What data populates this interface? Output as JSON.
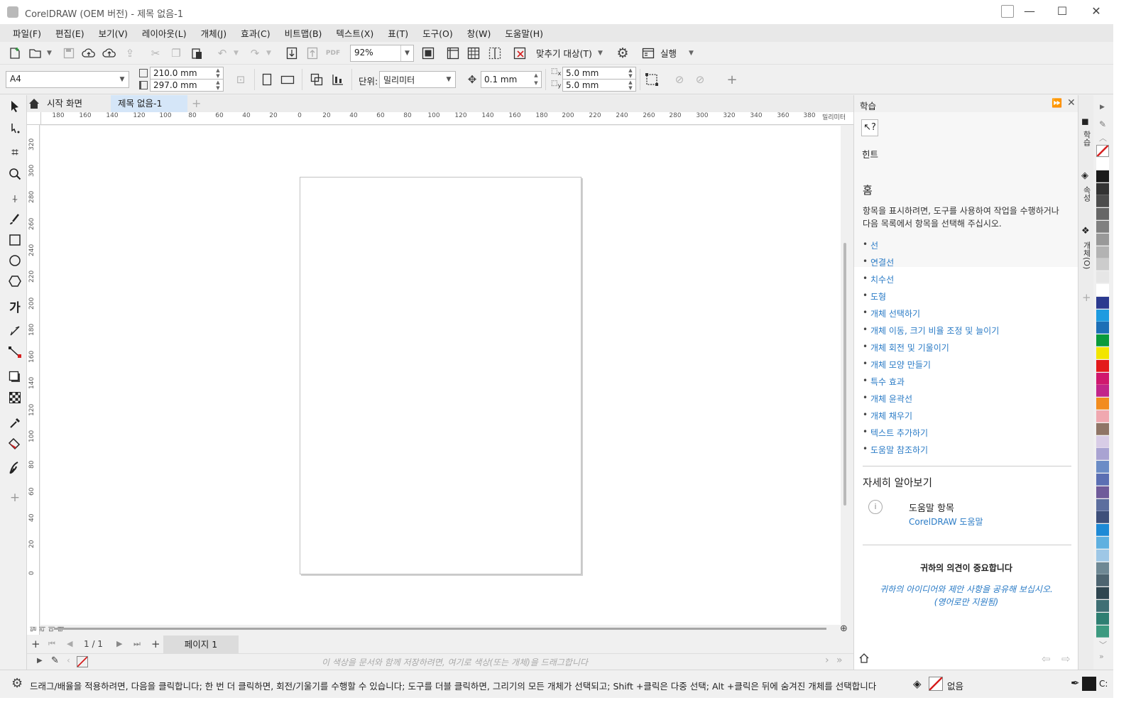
{
  "window": {
    "title": "CorelDRAW (OEM 버전) - 제목 없음-1",
    "controls": {
      "minimize": "—",
      "maximize": "☐",
      "close": "✕"
    }
  },
  "menu": [
    "파일(F)",
    "편집(E)",
    "보기(V)",
    "레이아웃(L)",
    "개체(J)",
    "효과(C)",
    "비트맵(B)",
    "텍스트(X)",
    "표(T)",
    "도구(O)",
    "창(W)",
    "도움말(H)"
  ],
  "toolbar": {
    "zoom_value": "92%",
    "snap_label": "맞추기 대상(T)",
    "launch_label": "실행",
    "pdf_label": "PDF"
  },
  "property_bar": {
    "page_size": "A4",
    "width": "210.0 mm",
    "height": "297.0 mm",
    "units_label": "단위:",
    "units_value": "밀리미터",
    "nudge": "0.1 mm",
    "dup_x": "5.0 mm",
    "dup_y": "5.0 mm",
    "dup_x_label": "x",
    "dup_y_label": "y"
  },
  "doc_tabs": {
    "home": "시작 화면",
    "active": "제목 없음-1",
    "add": "+"
  },
  "ruler": {
    "h_labels": [
      "180",
      "160",
      "140",
      "120",
      "100",
      "80",
      "60",
      "40",
      "20",
      "0",
      "20",
      "40",
      "60",
      "80",
      "100",
      "120",
      "140",
      "160",
      "180",
      "200",
      "220",
      "240",
      "260",
      "280",
      "300",
      "320",
      "340",
      "360",
      "380"
    ],
    "h_unit": "밀리미터",
    "v_labels": [
      "320",
      "300",
      "280",
      "260",
      "240",
      "220",
      "200",
      "180",
      "160",
      "140",
      "120",
      "100",
      "80",
      "60",
      "40",
      "20",
      "0"
    ],
    "v_unit": "밀리미터"
  },
  "page_nav": {
    "counter": "1 / 1",
    "page_tab": "페이지 1"
  },
  "doc_palette": {
    "hint": "이 색상을 문서와 함께 저장하려면, 여기로 색상(또는 개체)을 드래그합니다"
  },
  "docker": {
    "title": "학습",
    "hint_label": "힌트",
    "home_heading": "홈",
    "home_text": "항목을 표시하려면, 도구를 사용하여 작업을 수행하거나 다음 목록에서 항목을 선택해 주십시오.",
    "links": [
      "선",
      "연결선",
      "치수선",
      "도형",
      "개체 선택하기",
      "개체 이동, 크기 비율 조정 및 늘이기",
      "개체 회전 및 기울이기",
      "개체 모양 만들기",
      "특수 효과",
      "개체 윤곽선",
      "개체 채우기",
      "텍스트 추가하기",
      "도움말 참조하기"
    ],
    "learn_more": "자세히 알아보기",
    "help_items_label": "도움말 항목",
    "help_link": "CorelDRAW 도움말",
    "feedback_title": "귀하의 의견이 중요합니다",
    "feedback_line1": "귀하의 아이디어와 제안 사항을 공유해 보십시오.",
    "feedback_line2": "(영어로만 지원됨)"
  },
  "vertical_tabs": [
    "학습",
    "속성",
    "개체(O)"
  ],
  "palette_colors": [
    "#ffffff",
    "#1a1a1a",
    "#333333",
    "#4d4d4d",
    "#666666",
    "#808080",
    "#999999",
    "#b3b3b3",
    "#cccccc",
    "#e6e6e6",
    "#ffffff",
    "#2b3a8f",
    "#1e9be0",
    "#1d6fb6",
    "#0a9b3b",
    "#f2e500",
    "#e31a1c",
    "#d0186e",
    "#c2258a",
    "#f28c1e",
    "#f0a8b0",
    "#8f7566",
    "#d8cce6",
    "#a9a3d2",
    "#6b8cc6",
    "#5b6fb3",
    "#6f5b9a",
    "#5c6e9e",
    "#3e4f7a",
    "#1e8ad6",
    "#5fb0e0",
    "#9ec7e6",
    "#6e8894",
    "#4d6470",
    "#2f4650",
    "#3f6f74",
    "#2e7f72",
    "#3d9a80"
  ],
  "status": {
    "message": "드래그/배율을 적용하려면, 다음을 클릭합니다; 한 번 더 클릭하면, 회전/기울기를 수행할 수 있습니다; 도구를 더블 클릭하면, 그리기의 모든 개체가 선택되고; Shift +클릭은 다중 선택; Alt +클릭은 뒤에 숨겨진 개체를 선택합니다",
    "fill_value": "없음",
    "outline_value": "C:"
  }
}
